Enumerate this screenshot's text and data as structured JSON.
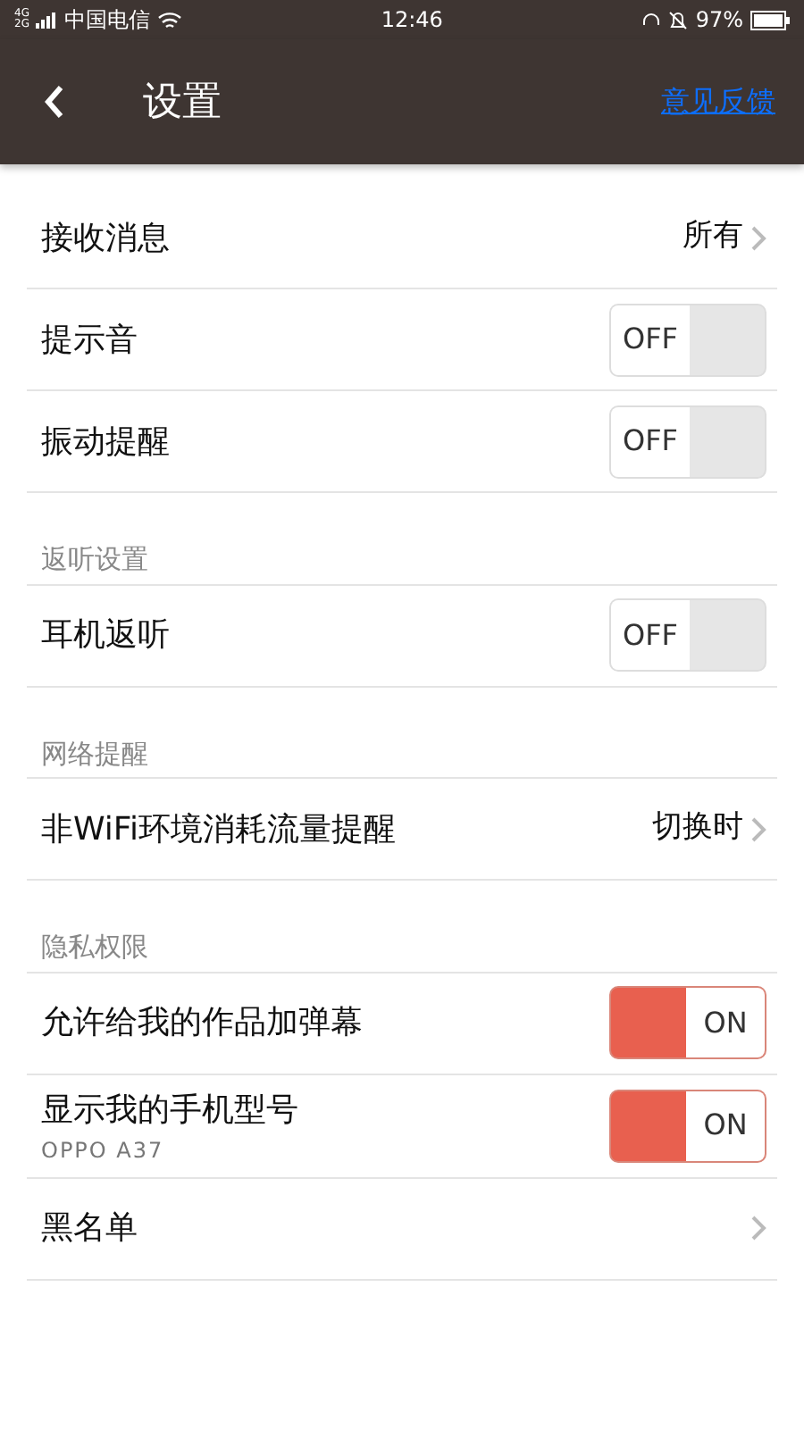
{
  "status_bar": {
    "network": "4G 2G",
    "carrier": "中国电信",
    "time": "12:46",
    "battery": "97%"
  },
  "header": {
    "title": "设置",
    "action": "意见反馈"
  },
  "sections": [
    {
      "rows": [
        {
          "kind": "link",
          "label": "接收消息",
          "value": "所有"
        },
        {
          "kind": "toggle",
          "label": "提示音",
          "on": false,
          "state_text": "OFF"
        },
        {
          "kind": "toggle",
          "label": "振动提醒",
          "on": false,
          "state_text": "OFF"
        }
      ]
    },
    {
      "title": "返听设置",
      "rows": [
        {
          "kind": "toggle",
          "label": "耳机返听",
          "on": false,
          "state_text": "OFF"
        }
      ]
    },
    {
      "title": "网络提醒",
      "rows": [
        {
          "kind": "link",
          "label": "非WiFi环境消耗流量提醒",
          "value": "切换时"
        }
      ]
    },
    {
      "title": "隐私权限",
      "rows": [
        {
          "kind": "toggle",
          "label": "允许给我的作品加弹幕",
          "on": true,
          "state_text": "ON"
        },
        {
          "kind": "toggle",
          "label": "显示我的手机型号",
          "subtitle": "OPPO A37",
          "on": true,
          "state_text": "ON"
        },
        {
          "kind": "link",
          "label": "黑名单"
        }
      ]
    }
  ]
}
